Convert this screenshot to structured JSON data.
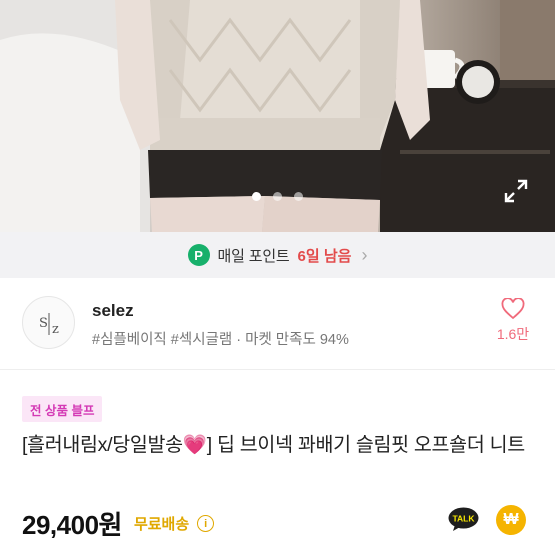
{
  "hero": {
    "dots_total": 3,
    "active_dot": 1
  },
  "points": {
    "badge": "P",
    "label": "매일 포인트",
    "days": "6일 남음",
    "chevron": "›"
  },
  "shop": {
    "avatar_text": "S|Z",
    "name": "selez",
    "tags": "#심플베이직 #섹시글램 · 마켓 만족도 94%",
    "like_count": "1.6만"
  },
  "product": {
    "promo": "전 상품 블프",
    "title_prefix": "[흘러내림x/당일발송",
    "title_emoji": "💗",
    "title_suffix": "] 딥 브이넥 꽈배기 슬림핏 오프숄더 니트",
    "price": "29,400원",
    "shipping": "무료배송",
    "info_icon": "i",
    "talk_label": "TALK",
    "won_symbol": "₩"
  },
  "colors": {
    "point_green": "#17b06b",
    "days_red": "#e34b4b",
    "like_pink": "#f06a7b",
    "promo_bg": "#fbe6f7",
    "promo_text": "#d43ab5",
    "shipping_yellow": "#e0a800",
    "kakao_yellow": "#f7e600"
  }
}
